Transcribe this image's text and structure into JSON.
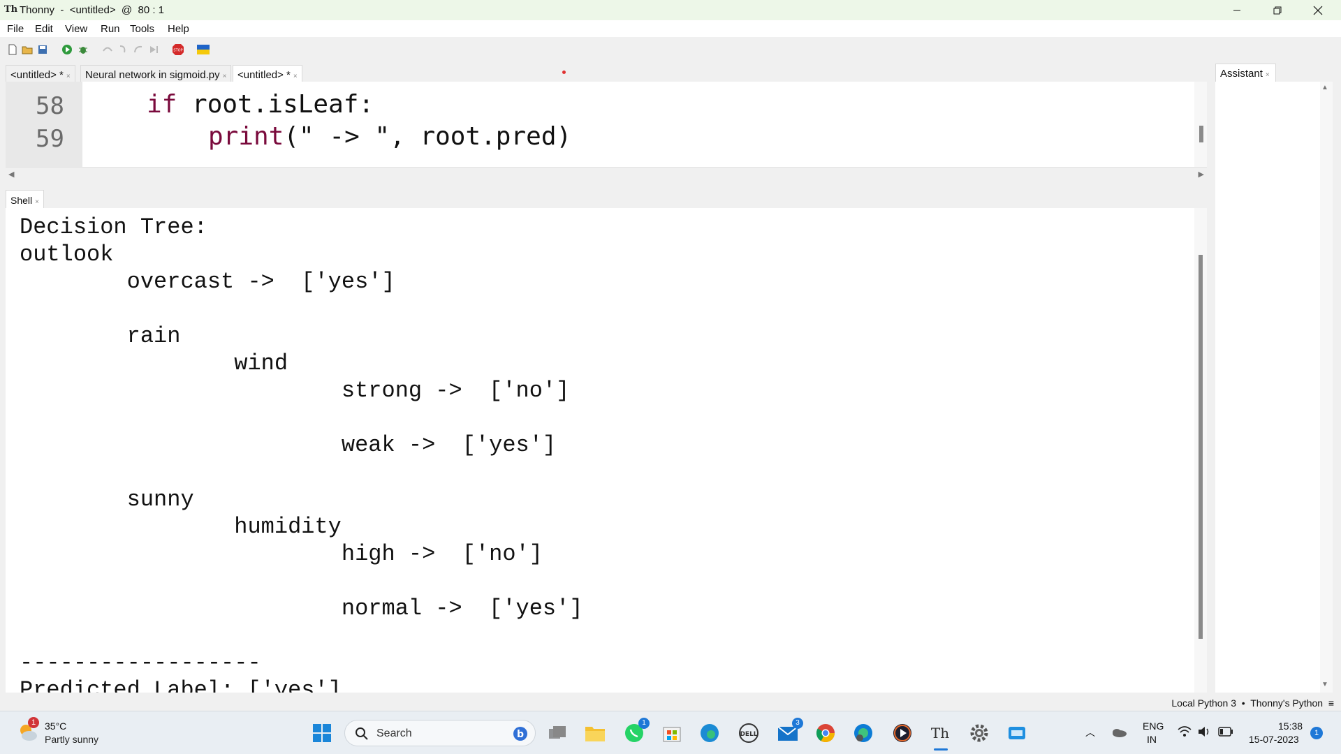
{
  "window": {
    "title": "Thonny  -  <untitled>  @  80 : 1",
    "minimize_icon": "minimize-icon",
    "maximize_icon": "restore-icon",
    "close_icon": "close-icon"
  },
  "menu": {
    "items": [
      "File",
      "Edit",
      "View",
      "Run",
      "Tools",
      "Help"
    ]
  },
  "toolbar": {
    "icons": [
      "new-file-icon",
      "open-file-icon",
      "save-icon",
      "run-icon",
      "debug-icon",
      "step-over-icon",
      "step-into-icon",
      "step-out-icon",
      "resume-icon",
      "stop-icon",
      "ukraine-flag-icon"
    ]
  },
  "editor_tabs": [
    {
      "label": "<untitled> *"
    },
    {
      "label": "Neural network in sigmoid.py"
    },
    {
      "label": "<untitled> *"
    }
  ],
  "editor": {
    "lines": [
      {
        "number": "58",
        "keyword": "if",
        "rest": " root.isLeaf:"
      },
      {
        "number": "59",
        "func": "print",
        "rest": "(\" -> \", root.pred)"
      }
    ]
  },
  "shell": {
    "tab_label": "Shell",
    "lines": [
      "Decision Tree:",
      "outlook",
      "        overcast ->  ['yes']",
      "",
      "        rain",
      "                wind",
      "                        strong ->  ['no']",
      "",
      "                        weak ->  ['yes']",
      "",
      "        sunny",
      "                humidity",
      "                        high ->  ['no']",
      "",
      "                        normal ->  ['yes']",
      "",
      "------------------",
      "Predicted Label: ['yes']"
    ]
  },
  "assistant": {
    "tab_label": "Assistant"
  },
  "statusbar": {
    "text": "Local Python 3  •  Thonny's Python  ≡"
  },
  "taskbar": {
    "weather_temp": "35°C",
    "weather_desc": "Partly sunny",
    "weather_badge": "1",
    "search_placeholder": "Search",
    "whatsapp_badge": "1",
    "mail_badge": "3",
    "language_top": "ENG",
    "language_bottom": "IN",
    "time": "15:38",
    "date": "15-07-2023",
    "notification_count": "1"
  }
}
